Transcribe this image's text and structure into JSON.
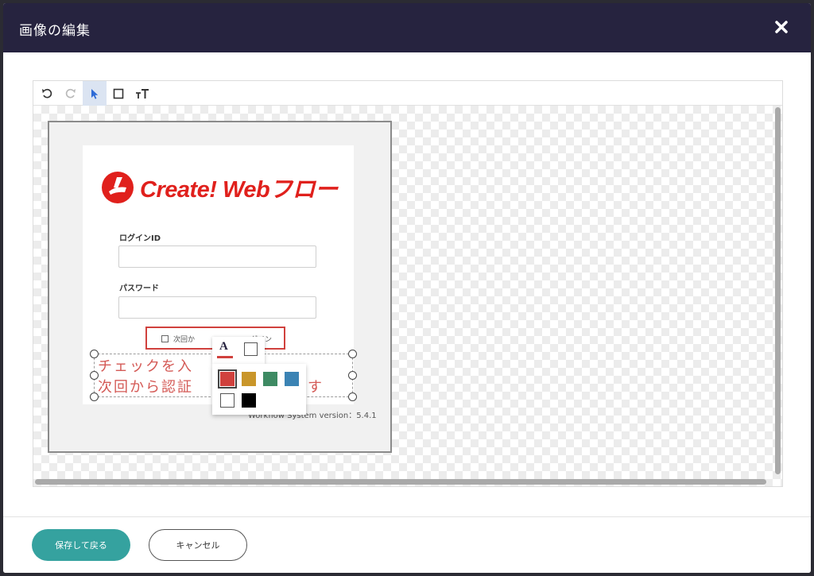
{
  "modal": {
    "title": "画像の編集"
  },
  "toolbar": {
    "tools": [
      {
        "name": "undo-icon",
        "state": "enabled"
      },
      {
        "name": "redo-icon",
        "state": "disabled"
      },
      {
        "name": "select-pointer-icon",
        "state": "active"
      },
      {
        "name": "rectangle-icon",
        "state": "enabled"
      },
      {
        "name": "text-icon",
        "state": "enabled"
      }
    ]
  },
  "image": {
    "logo_text": "Create! Webフロー",
    "login_id_label": "ログインID",
    "password_label": "パスワード",
    "remember_label": "次回か",
    "login_button_label": "グイン",
    "version_text": "Workflow System version：5.4.1"
  },
  "annotation": {
    "line1": "チェックを入",
    "line2": "次回から認証",
    "line2_suffix": "ります",
    "text_color": "#d45a56",
    "rect_color": "#d0413d"
  },
  "color_picker": {
    "tabs": [
      "font-color-icon",
      "background-color-icon"
    ],
    "font_color_letter": "A",
    "swatches": [
      {
        "name": "red",
        "color": "#d0413d",
        "selected": true
      },
      {
        "name": "gold",
        "color": "#c9962a",
        "selected": false
      },
      {
        "name": "green",
        "color": "#3e8a63",
        "selected": false
      },
      {
        "name": "blue",
        "color": "#3b83b4",
        "selected": false
      },
      {
        "name": "white",
        "color": "#ffffff",
        "selected": false
      },
      {
        "name": "black",
        "color": "#000000",
        "selected": false
      }
    ]
  },
  "footer": {
    "save_label": "保存して戻る",
    "cancel_label": "キャンセル"
  },
  "colors": {
    "header_bg": "#26233f",
    "accent": "#35a29f"
  }
}
